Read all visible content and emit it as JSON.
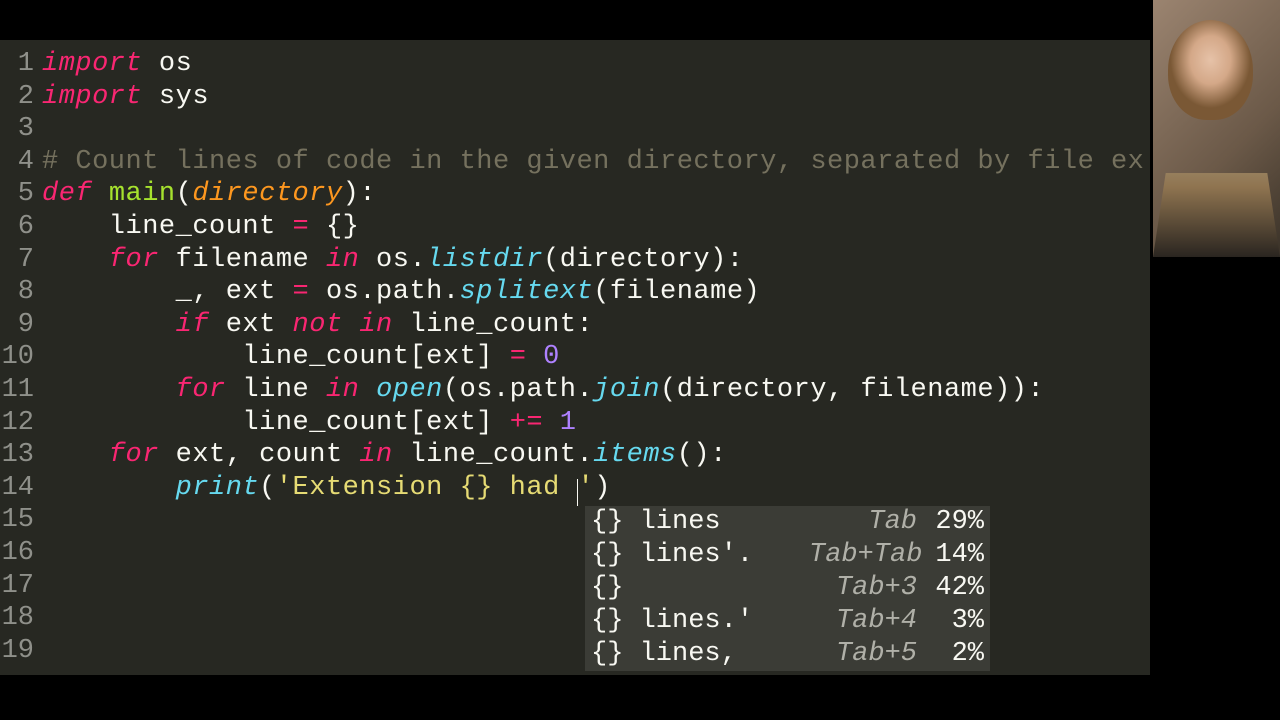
{
  "lines": [
    {
      "n": "1",
      "tokens": [
        {
          "c": "kw",
          "t": "import"
        },
        {
          "c": "pl",
          "t": " os"
        }
      ]
    },
    {
      "n": "2",
      "tokens": [
        {
          "c": "kw",
          "t": "import"
        },
        {
          "c": "pl",
          "t": " sys"
        }
      ]
    },
    {
      "n": "3",
      "tokens": []
    },
    {
      "n": "4",
      "tokens": [
        {
          "c": "cmt",
          "t": "# Count lines of code in the given directory, separated by file ex"
        }
      ]
    },
    {
      "n": "5",
      "tokens": [
        {
          "c": "kw",
          "t": "def"
        },
        {
          "c": "pl",
          "t": " "
        },
        {
          "c": "fn",
          "t": "main"
        },
        {
          "c": "pl",
          "t": "("
        },
        {
          "c": "param",
          "t": "directory"
        },
        {
          "c": "pl",
          "t": "):"
        }
      ]
    },
    {
      "n": "6",
      "tokens": [
        {
          "c": "pl",
          "t": "    line_count "
        },
        {
          "c": "op",
          "t": "="
        },
        {
          "c": "pl",
          "t": " {}"
        }
      ]
    },
    {
      "n": "7",
      "tokens": [
        {
          "c": "pl",
          "t": "    "
        },
        {
          "c": "kw",
          "t": "for"
        },
        {
          "c": "pl",
          "t": " filename "
        },
        {
          "c": "kw",
          "t": "in"
        },
        {
          "c": "pl",
          "t": " os."
        },
        {
          "c": "fnm",
          "t": "listdir"
        },
        {
          "c": "pl",
          "t": "(directory):"
        }
      ]
    },
    {
      "n": "8",
      "tokens": [
        {
          "c": "pl",
          "t": "        _, ext "
        },
        {
          "c": "op",
          "t": "="
        },
        {
          "c": "pl",
          "t": " os.path."
        },
        {
          "c": "fnm",
          "t": "splitext"
        },
        {
          "c": "pl",
          "t": "(filename)"
        }
      ]
    },
    {
      "n": "9",
      "tokens": [
        {
          "c": "pl",
          "t": "        "
        },
        {
          "c": "kw",
          "t": "if"
        },
        {
          "c": "pl",
          "t": " ext "
        },
        {
          "c": "kw",
          "t": "not in"
        },
        {
          "c": "pl",
          "t": " line_count:"
        }
      ]
    },
    {
      "n": "10",
      "tokens": [
        {
          "c": "pl",
          "t": "            line_count[ext] "
        },
        {
          "c": "op",
          "t": "="
        },
        {
          "c": "pl",
          "t": " "
        },
        {
          "c": "num",
          "t": "0"
        }
      ]
    },
    {
      "n": "11",
      "tokens": [
        {
          "c": "pl",
          "t": "        "
        },
        {
          "c": "kw",
          "t": "for"
        },
        {
          "c": "pl",
          "t": " line "
        },
        {
          "c": "kw",
          "t": "in"
        },
        {
          "c": "pl",
          "t": " "
        },
        {
          "c": "fnm",
          "t": "open"
        },
        {
          "c": "pl",
          "t": "(os.path."
        },
        {
          "c": "fnm",
          "t": "join"
        },
        {
          "c": "pl",
          "t": "(directory, filename)):"
        }
      ]
    },
    {
      "n": "12",
      "tokens": [
        {
          "c": "pl",
          "t": "            line_count[ext] "
        },
        {
          "c": "op",
          "t": "+="
        },
        {
          "c": "pl",
          "t": " "
        },
        {
          "c": "num",
          "t": "1"
        }
      ]
    },
    {
      "n": "13",
      "tokens": [
        {
          "c": "pl",
          "t": "    "
        },
        {
          "c": "kw",
          "t": "for"
        },
        {
          "c": "pl",
          "t": " ext, count "
        },
        {
          "c": "kw",
          "t": "in"
        },
        {
          "c": "pl",
          "t": " line_count."
        },
        {
          "c": "fnm",
          "t": "items"
        },
        {
          "c": "pl",
          "t": "():"
        }
      ]
    },
    {
      "n": "14",
      "tokens": [
        {
          "c": "pl",
          "t": "        "
        },
        {
          "c": "fnm",
          "t": "print"
        },
        {
          "c": "pl",
          "t": "("
        },
        {
          "c": "str",
          "t": "'Extension {} had "
        },
        {
          "c": "cursor",
          "t": ""
        },
        {
          "c": "str",
          "t": "'"
        },
        {
          "c": "pl",
          "t": ")"
        }
      ]
    },
    {
      "n": "15",
      "tokens": []
    },
    {
      "n": "16",
      "tokens": []
    },
    {
      "n": "17",
      "tokens": []
    },
    {
      "n": "18",
      "tokens": []
    },
    {
      "n": "19",
      "tokens": []
    }
  ],
  "autocomplete": [
    {
      "text": "{} lines",
      "key": "Tab",
      "pct": "29%"
    },
    {
      "text": "{} lines'.",
      "key": "Tab+Tab",
      "pct": "14%"
    },
    {
      "text": "{}",
      "key": "Tab+3",
      "pct": "42%"
    },
    {
      "text": "{} lines.'",
      "key": "Tab+4",
      "pct": "3%"
    },
    {
      "text": "{} lines,",
      "key": "Tab+5",
      "pct": "2%"
    }
  ],
  "webcam": {
    "placeholder_label": "presenter-webcam"
  }
}
